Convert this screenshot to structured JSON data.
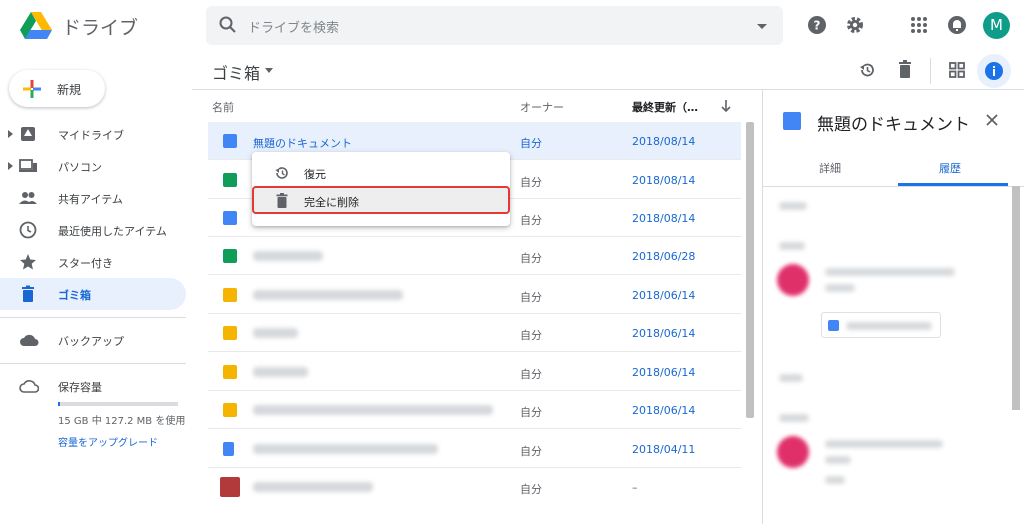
{
  "app": {
    "brand": "ドライブ",
    "search_placeholder": "ドライブを検索",
    "avatar_letter": "M"
  },
  "colors": {
    "accent": "#1a73e8",
    "selection": "#e8f0fe",
    "highlight_border": "#e53935"
  },
  "toolbar": {
    "breadcrumb": "ゴミ箱"
  },
  "sidebar": {
    "new_label": "新規",
    "items": [
      {
        "label": "マイドライブ",
        "icon": "drive-icon"
      },
      {
        "label": "パソコン",
        "icon": "computer-icon"
      },
      {
        "label": "共有アイテム",
        "icon": "people-icon"
      },
      {
        "label": "最近使用したアイテム",
        "icon": "clock-icon"
      },
      {
        "label": "スター付き",
        "icon": "star-icon"
      },
      {
        "label": "ゴミ箱",
        "icon": "trash-icon"
      },
      {
        "label": "バックアップ",
        "icon": "cloud-icon"
      },
      {
        "label": "保存容量",
        "icon": "cloud-outline-icon"
      }
    ],
    "storage_text": "15 GB 中 127.2 MB を使用",
    "upgrade_link": "容量をアップグレード"
  },
  "list": {
    "headers": {
      "name": "名前",
      "owner": "オーナー",
      "modified": "最終更新（…"
    },
    "rows": [
      {
        "name": "無題のドキュメント",
        "owner": "自分",
        "date": "2018/08/14",
        "type": "doc"
      },
      {
        "name": "",
        "owner": "自分",
        "date": "2018/08/14",
        "type": "sheet"
      },
      {
        "name": "",
        "owner": "自分",
        "date": "2018/08/14",
        "type": "doc"
      },
      {
        "name": "",
        "owner": "自分",
        "date": "2018/06/28",
        "type": "sheet"
      },
      {
        "name": "",
        "owner": "自分",
        "date": "2018/06/14",
        "type": "slide"
      },
      {
        "name": "",
        "owner": "自分",
        "date": "2018/06/14",
        "type": "slide"
      },
      {
        "name": "",
        "owner": "自分",
        "date": "2018/06/14",
        "type": "slide"
      },
      {
        "name": "",
        "owner": "自分",
        "date": "2018/06/14",
        "type": "slide"
      },
      {
        "name": "",
        "owner": "自分",
        "date": "2018/04/11",
        "type": "docfile"
      },
      {
        "name": "",
        "owner": "自分",
        "date": "–",
        "type": "image"
      }
    ]
  },
  "context_menu": {
    "restore": "復元",
    "delete_forever": "完全に削除"
  },
  "details": {
    "title": "無題のドキュメント",
    "tabs": [
      "詳細",
      "履歴"
    ]
  }
}
